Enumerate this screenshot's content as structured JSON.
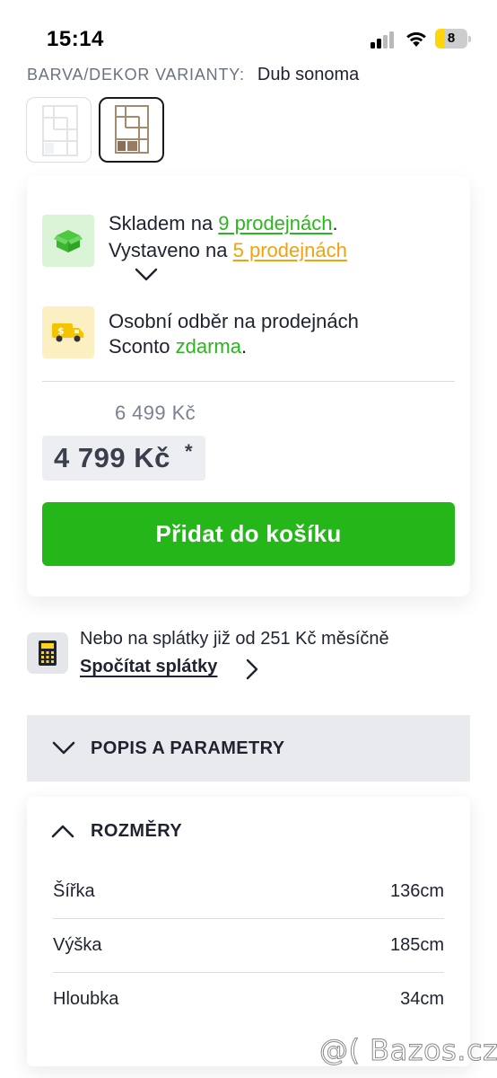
{
  "status_bar": {
    "time": "15:14",
    "battery_level": "8",
    "icons": [
      "signal-icon",
      "wifi-icon",
      "battery-icon"
    ]
  },
  "variant": {
    "label": "BARVA/DEKOR VARIANTY:",
    "value": "Dub sonoma",
    "swatches": [
      {
        "name": "white",
        "selected": false
      },
      {
        "name": "Dub sonoma",
        "selected": true
      }
    ]
  },
  "availability": {
    "stock_prefix": "Skladem na ",
    "stock_link": "9 prodejnách",
    "stock_suffix": ".",
    "display_prefix": "Vystaveno na ",
    "display_link": "5 prodejnách",
    "pickup_line1": "Osobní odběr na prodejnách",
    "pickup_line2_prefix": "Sconto ",
    "pickup_free": "zdarma",
    "pickup_line2_suffix": "."
  },
  "pricing": {
    "old_price": "6 499 Kč",
    "price": "4 799 Kč",
    "price_note_marker": "*",
    "add_to_cart_label": "Přidat do košíku"
  },
  "installments": {
    "text": "Nebo na splátky již od 251 Kč měsíčně",
    "link": "Spočítat splátky"
  },
  "accordion": {
    "description_title": "POPIS A PARAMETRY",
    "dimensions_title": "ROZMĚRY",
    "dimensions": [
      {
        "label": "Šířka",
        "value": "136cm"
      },
      {
        "label": "Výška",
        "value": "185cm"
      },
      {
        "label": "Hloubka",
        "value": "34cm"
      }
    ]
  },
  "watermark": "@( Bazos.cz",
  "colors": {
    "accent_green": "#25b61a",
    "link_orange": "#f2a30c",
    "text_dark": "#1f2330"
  }
}
